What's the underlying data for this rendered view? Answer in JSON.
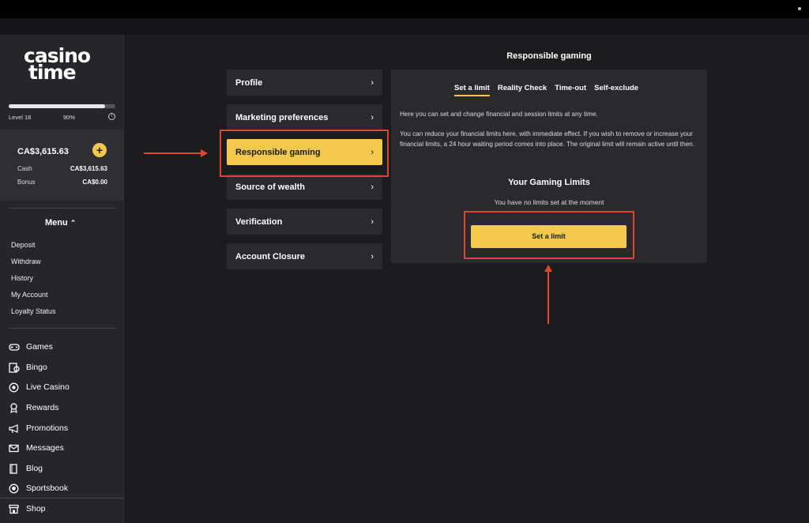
{
  "brand": {
    "line1": "casino",
    "line2": "time"
  },
  "player": {
    "level": "Level 18",
    "progress_percent": "90%",
    "progress_value": 0.9
  },
  "balance": {
    "total": "CA$3,615.63",
    "cash_label": "Cash",
    "cash_value": "CA$3,615.63",
    "bonus_label": "Bonus",
    "bonus_value": "CA$0.00"
  },
  "menu": {
    "title": "Menu",
    "links": [
      "Deposit",
      "Withdraw",
      "History",
      "My Account",
      "Loyalty Status"
    ]
  },
  "nav": {
    "items": [
      {
        "label": "Games",
        "icon": "gamepad-icon"
      },
      {
        "label": "Bingo",
        "icon": "bingo-icon"
      },
      {
        "label": "Live Casino",
        "icon": "live-icon"
      },
      {
        "label": "Rewards",
        "icon": "award-icon"
      },
      {
        "label": "Promotions",
        "icon": "megaphone-icon"
      },
      {
        "label": "Messages",
        "icon": "mail-icon"
      },
      {
        "label": "Blog",
        "icon": "book-icon"
      },
      {
        "label": "Sportsbook",
        "icon": "ball-icon"
      },
      {
        "label": "Shop",
        "icon": "shop-icon"
      }
    ]
  },
  "page": {
    "title": "Responsible gaming"
  },
  "account_menu": {
    "items": [
      "Profile",
      "Marketing preferences",
      "Responsible gaming",
      "Source of wealth",
      "Verification",
      "Account Closure"
    ],
    "active": "Responsible gaming"
  },
  "tabs": [
    "Set a limit",
    "Reality Check",
    "Time-out",
    "Self-exclude"
  ],
  "content": {
    "intro": "Here you can set and change financial and session limits at any time.",
    "details": "You can reduce your financial limits here, with immediate effect. If you wish to remove or increase your financial limits, a 24 hour waiting period comes into place. The original limit will remain active until then.",
    "limits_title": "Your Gaming Limits",
    "no_limits": "You have no limits set at the moment",
    "set_limit_button": "Set a limit"
  },
  "colors": {
    "accent": "#f2c94c",
    "annotation": "#e0462e"
  }
}
